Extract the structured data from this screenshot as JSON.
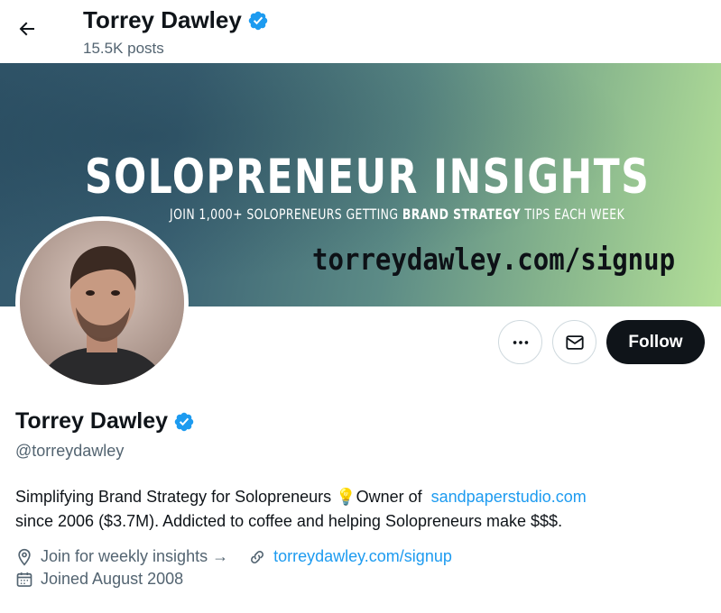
{
  "header": {
    "name": "Torrey Dawley",
    "posts": "15.5K posts"
  },
  "banner": {
    "title": "SOLOPRENEUR INSIGHTS",
    "subtitle_pre": "JOIN 1,000+ SOLOPRENEURS GETTING ",
    "subtitle_bold": "BRAND STRATEGY",
    "subtitle_post": " TIPS EACH WEEK",
    "url": "torreydawley.com/signup"
  },
  "actions": {
    "more_icon": "more-horizontal-icon",
    "message_icon": "envelope-icon",
    "follow_label": "Follow"
  },
  "profile": {
    "name": "Torrey Dawley",
    "handle": "@torreydawley",
    "bio_line1_pre": "Simplifying Brand Strategy for Solopreneurs ",
    "bio_emoji": "💡",
    "bio_line1_mid": "Owner of  ",
    "bio_link": "sandpaperstudio.com",
    "bio_line2": "since 2006 ($3.7M). Addicted to coffee and helping Solopreneurs make $$$.",
    "location": "Join for weekly insights →",
    "website": "torreydawley.com/signup",
    "joined": "Joined August 2008"
  },
  "colors": {
    "accent": "#1d9bf0",
    "text": "#0f1419",
    "secondary": "#536471",
    "verified": "#1d9bf0"
  }
}
